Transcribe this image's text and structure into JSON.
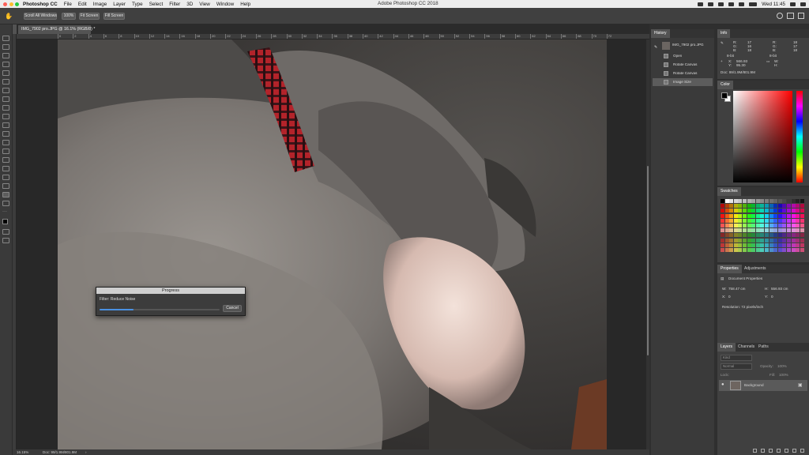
{
  "menubar": {
    "app_name": "Photoshop CC",
    "items": [
      "File",
      "Edit",
      "Image",
      "Layer",
      "Type",
      "Select",
      "Filter",
      "3D",
      "View",
      "Window",
      "Help"
    ],
    "window_title": "Adobe Photoshop CC 2018",
    "clock": "Wed 11:45"
  },
  "options_bar": {
    "scroll_all_windows": "Scroll All Windows",
    "zoom_100": "100%",
    "fit_screen": "Fit Screen",
    "fill_screen": "Fill Screen"
  },
  "document": {
    "tab_title": "IMG_7902 pro.JPG @ 16.1% (RGB/8) *",
    "zoom_status": "16.15%",
    "doc_status": "Doc: 99/1.9M/801.9M"
  },
  "ruler": {
    "ticks": [
      "0",
      "2",
      "4",
      "6",
      "8",
      "10",
      "12",
      "14",
      "16",
      "18",
      "20",
      "22",
      "24",
      "26",
      "28",
      "30",
      "32",
      "34",
      "36",
      "38",
      "40",
      "42",
      "44",
      "46",
      "48",
      "50",
      "52",
      "54",
      "56",
      "58",
      "60",
      "62",
      "64",
      "66",
      "68",
      "70",
      "72"
    ]
  },
  "progress_dialog": {
    "title": "Progress",
    "filter_label": "Filter: Reduce Noise",
    "progress": 0.28,
    "cancel": "Cancel"
  },
  "history": {
    "tab": "History",
    "snapshot": "IMG_7902 pro.JPG",
    "items": [
      "Open",
      "Rotate Canvas",
      "Rotate Canvas",
      "Image Size"
    ],
    "selected_index": 3
  },
  "info": {
    "tab": "Info",
    "r_label": "R:",
    "g_label": "G:",
    "b_label": "B:",
    "r1": "17",
    "g1": "16",
    "b1": "18",
    "r2": "18",
    "g2": "17",
    "b2": "18",
    "bit1": "8-bit",
    "bit2": "8-bit",
    "x_label": "X:",
    "y_label": "Y:",
    "x_val": "566.93",
    "y_val": "95.30",
    "w_label": "W:",
    "h_label": "H:",
    "doc": "Doc: 99/1.9M/801.9M"
  },
  "color_panel": {
    "tab": "Color",
    "fg": "#000000",
    "bg": "#ffffff",
    "hue": "#ff0000"
  },
  "swatches": {
    "tab": "Swatches"
  },
  "properties": {
    "tabs": [
      "Properties",
      "Adjustments"
    ],
    "heading": "Document Properties",
    "w_label": "W:",
    "w_val": "758.47 cm",
    "h_label": "H:",
    "h_val": "556.93 cm",
    "x_label": "X:",
    "x_val": "0",
    "y_label": "Y:",
    "y_val": "0",
    "resolution": "Resolution: 72 pixels/inch"
  },
  "layers": {
    "tabs": [
      "Layers",
      "Channels",
      "Paths"
    ],
    "kind_placeholder": "Kind",
    "mode": "Normal",
    "opacity_label": "Opacity:",
    "opacity_val": "100%",
    "lock_label": "Lock:",
    "fill_label": "Fill:",
    "fill_val": "100%",
    "background_layer": "Background"
  },
  "colors": {
    "accent": "#4a90e2",
    "panel": "#404040",
    "canvas": "#282828"
  }
}
